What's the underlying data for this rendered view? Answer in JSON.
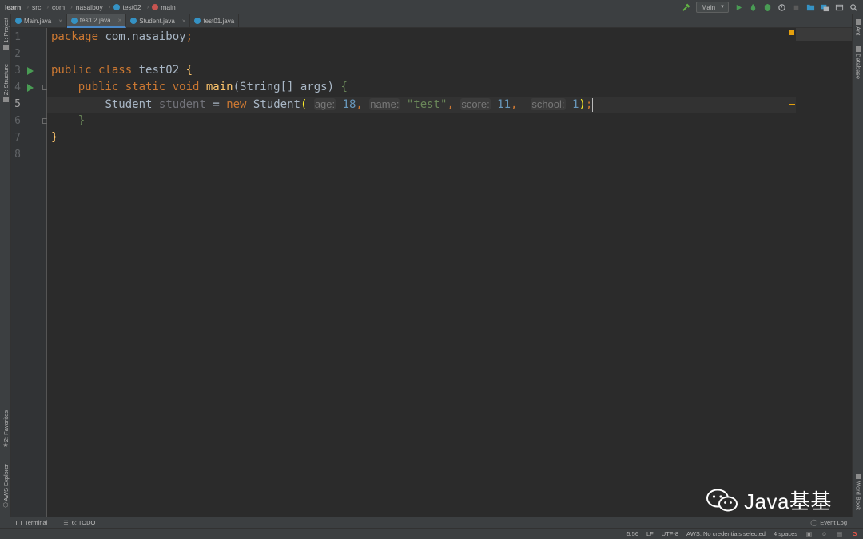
{
  "breadcrumbs": [
    {
      "label": "learn",
      "bold": true,
      "icon": ""
    },
    {
      "label": "src",
      "bold": false,
      "icon": ""
    },
    {
      "label": "com",
      "bold": false,
      "icon": ""
    },
    {
      "label": "nasaiboy",
      "bold": false,
      "icon": ""
    },
    {
      "label": "test02",
      "bold": false,
      "icon": "class-icon"
    },
    {
      "label": "main",
      "bold": false,
      "icon": "method-icon"
    }
  ],
  "toolbar": {
    "run_config": "Main",
    "icons": [
      "build-hammer-icon",
      "run-icon",
      "debug-icon",
      "coverage-icon",
      "profile-icon",
      "stop-icon",
      "project-structure-icon",
      "sdk-icon",
      "window-icon",
      "search-icon"
    ]
  },
  "tabs": [
    {
      "label": "Main.java",
      "active": false
    },
    {
      "label": "test02.java",
      "active": true
    },
    {
      "label": "Student.java",
      "active": false
    },
    {
      "label": "test01.java",
      "active": false
    }
  ],
  "left_tools": {
    "project": "1: Project",
    "structure": "Z: Structure",
    "favorites": "2: Favorites",
    "aws": "AWS Explorer"
  },
  "right_tools": {
    "ant": "Ant",
    "database": "Database",
    "wordbook": "Word Book"
  },
  "editor": {
    "line_numbers": [
      "1",
      "2",
      "3",
      "4",
      "5",
      "6",
      "7",
      "8"
    ],
    "current_line": "5",
    "code": {
      "l1_kw": "package",
      "l1_rest": " com.nasaiboy",
      "l1_semi": ";",
      "l3_kw": "public class",
      "l3_name": " test02 ",
      "l3_brace": "{",
      "l4_kw": "public static void",
      "l4_fn": "main",
      "l4_args": "(String[] args) ",
      "l4_brace": "{",
      "l5_type": "Student",
      "l5_var": "student",
      "l5_eq": " = ",
      "l5_new": "new",
      "l5_ctor": " Student",
      "l5_open": "(",
      "hint_age": "age:",
      "val_age": "18",
      "hint_name": "name:",
      "val_name": "\"test\"",
      "hint_score": "score:",
      "val_score": "11",
      "hint_school": "school:",
      "val_school": "1",
      "l5_close": ")",
      "l5_semi": ";",
      "comma": ",",
      "l6_brace": "}",
      "l7_brace": "}"
    }
  },
  "bottom_tools": {
    "terminal": "Terminal",
    "todo": "6: TODO",
    "event_log": "Event Log"
  },
  "status": {
    "position": "5:56",
    "line_sep": "LF",
    "encoding": "UTF-8",
    "aws": "AWS: No credentials selected",
    "indent": "4 spaces"
  },
  "watermark": {
    "text": "Java基基"
  },
  "colors": {
    "editor_bg": "#2b2b2b",
    "keyword": "#cc7832",
    "number": "#6897bb",
    "string": "#6a8759",
    "function": "#ffc66d",
    "run_green": "#499c54"
  }
}
